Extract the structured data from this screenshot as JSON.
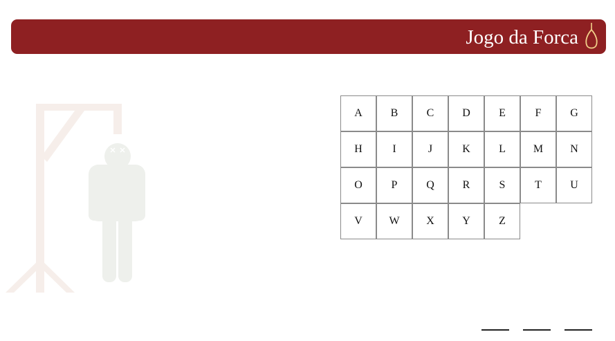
{
  "header": {
    "title": "Jogo da Forca",
    "icon": "noose-icon"
  },
  "colors": {
    "header_bg": "#8e2022",
    "noose_outline": "#f1cf89",
    "gallows": "#f6eeea",
    "figure": "#eef0ec",
    "key_border": "#8a8a8a"
  },
  "gallows": {
    "icon": "hangman-figure",
    "errors_shown": 6
  },
  "keyboard": {
    "rows": [
      [
        "A",
        "B",
        "C",
        "D",
        "E",
        "F",
        "G"
      ],
      [
        "H",
        "I",
        "J",
        "K",
        "L",
        "M",
        "N"
      ],
      [
        "O",
        "P",
        "Q",
        "R",
        "S",
        "T",
        "U"
      ],
      [
        "V",
        "W",
        "X",
        "Y",
        "Z"
      ]
    ]
  },
  "word": {
    "letters": [
      "",
      "",
      ""
    ]
  }
}
